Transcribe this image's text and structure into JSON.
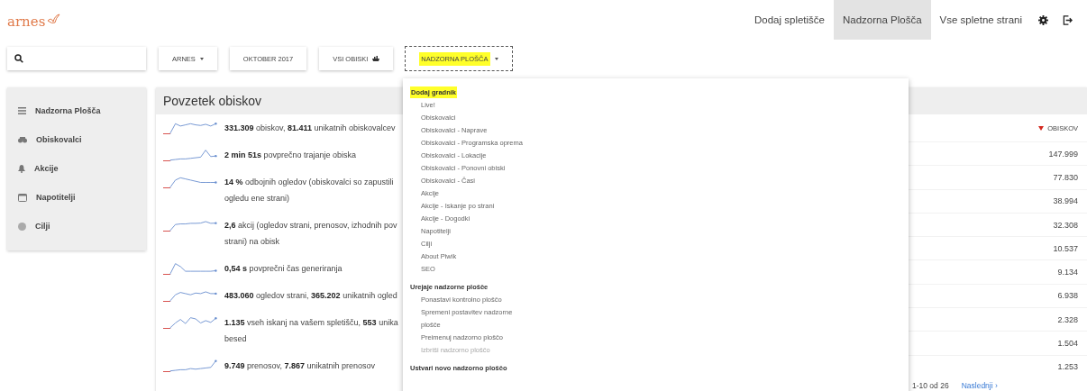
{
  "logo": {
    "text": "arnes"
  },
  "nav": [
    {
      "label": "Dodaj spletišče",
      "selected": false
    },
    {
      "label": "Nadzorna Plošča",
      "selected": true
    },
    {
      "label": "Vse spletne strani",
      "selected": false
    }
  ],
  "toolbar": [
    {
      "label": "ARNES",
      "kind": "dropdown",
      "highlighted": false
    },
    {
      "label": "OKTOBER 2017",
      "kind": "plain",
      "highlighted": false
    },
    {
      "label": "VSI OBISKI",
      "kind": "segment",
      "highlighted": false
    },
    {
      "label": "NADZORNA PLOŠČA",
      "kind": "dropdown",
      "highlighted": true
    }
  ],
  "sidebar": {
    "items": [
      {
        "label": "Nadzorna Plošča",
        "selected": false
      },
      {
        "label": "Obiskovalci",
        "selected": false
      },
      {
        "label": "Akcije",
        "selected": false
      },
      {
        "label": "Napotitelji",
        "selected": false
      },
      {
        "label": "Cilji",
        "selected": false
      }
    ]
  },
  "summary": {
    "title": "Povzetek obiskov",
    "rows": [
      {
        "text": "**331.309** obiskov, **81.411** unikatnih obiskovalcev"
      },
      {
        "text": "**2 min 51s** povprečno trajanje obiska"
      },
      {
        "text": "**14 %** odbojnih ogledov (obiskovalci so zapustili\nogledu ene strani)"
      },
      {
        "text": "**2,6** akcij (ogledov strani, prenosov, izhodnih pov\nstrani) na obisk"
      },
      {
        "text": "**0,54 s** povprečni čas generiranja"
      },
      {
        "text": "**483.060** ogledov strani, **365.202** unikatnih ogled"
      },
      {
        "text": "**1.135** vseh iskanj na vašem spletišču, **553** unika\nbesed"
      },
      {
        "text": "**9.749** prenosov, **7.867** unikatnih prenosov"
      }
    ]
  },
  "table": {
    "column": "OBISKOV",
    "rows": [
      "147.999",
      "77.830",
      "38.994",
      "32.308",
      "10.537",
      "9.134",
      "6.938",
      "2.328",
      "1.504",
      "1.253"
    ],
    "range": "1-10 od 26",
    "next": "Naslednji ›"
  },
  "menu": {
    "sections": [
      {
        "title": "Dodaj gradnik",
        "highlighted": true,
        "items": [
          {
            "label": "Live!",
            "disabled": false
          },
          {
            "label": "Obiskovalci",
            "disabled": false
          },
          {
            "label": "Obiskovalci - Naprave",
            "disabled": false
          },
          {
            "label": "Obiskovalci - Programska oprema",
            "disabled": false
          },
          {
            "label": "Obiskovalci - Lokacije",
            "disabled": false
          },
          {
            "label": "Obiskovalci - Ponovni obiski",
            "disabled": false
          },
          {
            "label": "Obiskovalci - Časi",
            "disabled": false
          },
          {
            "label": "Akcije",
            "disabled": false
          },
          {
            "label": "Akcije - Iskanje po strani",
            "disabled": false
          },
          {
            "label": "Akcije - Dogodki",
            "disabled": false
          },
          {
            "label": "Napotitelji",
            "disabled": false
          },
          {
            "label": "Cilji",
            "disabled": false
          },
          {
            "label": "About Piwik",
            "disabled": false
          },
          {
            "label": "SEO",
            "disabled": false
          }
        ]
      },
      {
        "title": "Urejaje nadzorne plošče",
        "highlighted": false,
        "items": [
          {
            "label": "Ponastavi kontrolno ploščo",
            "disabled": false
          },
          {
            "label": "Spremeni postavitev nadzorne\nplošče",
            "disabled": false
          },
          {
            "label": "Preimenuj nadzorno ploščo",
            "disabled": false
          },
          {
            "label": "Izbriši nadzorno ploščo",
            "disabled": true
          }
        ]
      },
      {
        "title": "Ustvari novo nadzorno ploščo",
        "highlighted": false
      }
    ]
  }
}
